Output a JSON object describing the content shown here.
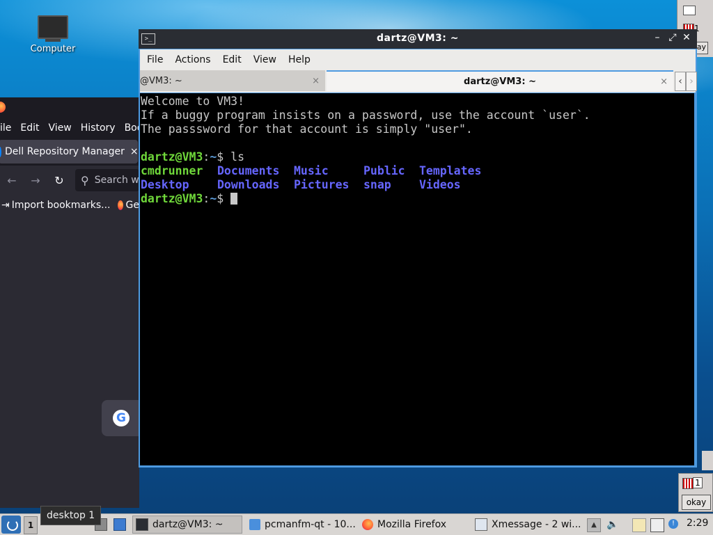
{
  "desktop": {
    "icons": [
      {
        "label": "Computer",
        "icon": "monitor-icon"
      }
    ]
  },
  "firefox": {
    "menu": [
      "ile",
      "Edit",
      "View",
      "History",
      "Boo"
    ],
    "tab_title": "Dell Repository Manager",
    "tab_close": "×",
    "search_placeholder": "Search w",
    "bookmarks": [
      {
        "label": "Import bookmarks..."
      },
      {
        "label": "Ge"
      }
    ]
  },
  "terminal": {
    "window_title": "dartz@VM3: ~",
    "menu": [
      "File",
      "Actions",
      "Edit",
      "View",
      "Help"
    ],
    "tabs": [
      {
        "label": "@VM3: ~",
        "active": false
      },
      {
        "label": "dartz@VM3: ~",
        "active": true
      }
    ],
    "tab_close": "×",
    "lines": [
      "Welcome to VM3!",
      "If a buggy program insists on a password, use the account `user`.",
      "The passsword for that account is simply \"user\"."
    ],
    "prompt_user": "dartz@VM3",
    "prompt_colon": ":",
    "prompt_cwd": "~",
    "prompt_symbol": "$ ",
    "command": "ls",
    "ls_row1": [
      "cmdrunner",
      "Documents",
      "Music",
      "Public",
      "Templates"
    ],
    "ls_row2": [
      "Desktop",
      "Downloads",
      "Pictures",
      "snap",
      "Videos"
    ]
  },
  "xmessage": {
    "number": "1",
    "button": "okay"
  },
  "taskbar": {
    "desktop_number": "1",
    "tooltip": "desktop 1",
    "items": [
      {
        "label": "dartz@VM3: ~",
        "icon": "terminal-icon",
        "active": true
      },
      {
        "label": "pcmanfm-qt - 10...",
        "icon": "folder-icon",
        "active": false
      },
      {
        "label": "Mozilla Firefox",
        "icon": "firefox-icon",
        "active": false
      },
      {
        "label": "Xmessage - 2 wi...",
        "icon": "window-icon",
        "active": false
      }
    ],
    "clock": "2:29"
  },
  "colors": {
    "terminal_accent": "#4d9ae0",
    "prompt_green": "#6fd73a",
    "dir_blue": "#6666ff",
    "firefox_bg": "#2b2a33"
  }
}
